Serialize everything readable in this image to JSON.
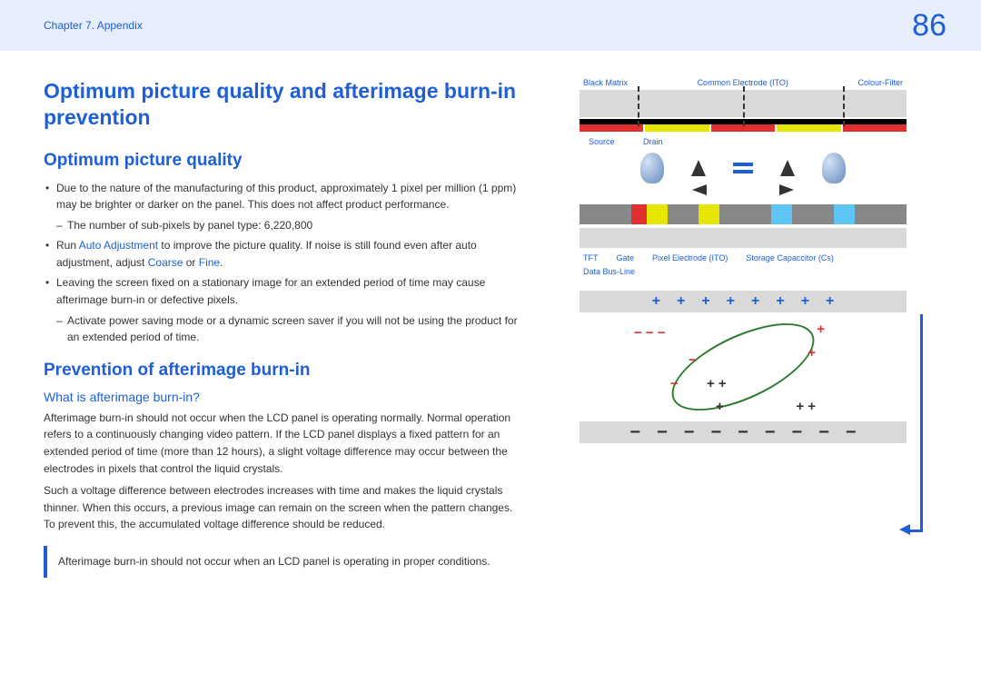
{
  "header": {
    "chapter": "Chapter 7. Appendix",
    "page": "86"
  },
  "title": "Optimum picture quality and afterimage burn-in prevention",
  "section1": {
    "heading": "Optimum picture quality",
    "b1": "Due to the nature of the manufacturing of this product, approximately 1 pixel per million (1 ppm) may be brighter or darker on the panel. This does not affect product performance.",
    "d1": "The number of sub-pixels by panel type: 6,220,800",
    "b2a": "Run ",
    "b2link": "Auto Adjustment",
    "b2b": " to improve the picture quality. If noise is still found even after auto adjustment, adjust ",
    "b2link2": "Coarse",
    "b2c": " or ",
    "b2link3": "Fine",
    "b2d": ".",
    "b3": "Leaving the screen fixed on a stationary image for an extended period of time may cause afterimage burn-in or defective pixels.",
    "d2": "Activate power saving mode or a dynamic screen saver if you will not be using the product for an extended period of time."
  },
  "section2": {
    "heading": "Prevention of afterimage burn-in",
    "sub": "What is afterimage burn-in?",
    "p1": "Afterimage burn-in should not occur when the LCD panel is operating normally. Normal operation refers to a continuously changing video pattern. If the LCD panel displays a fixed pattern for an extended period of time (more than 12 hours), a slight voltage difference may occur between the electrodes in pixels that control the liquid crystals.",
    "p2": "Such a voltage difference between electrodes increases with time and makes the liquid crystals thinner. When this occurs, a previous image can remain on the screen when the pattern changes. To prevent this, the accumulated voltage difference should be reduced.",
    "note": "Afterimage burn-in should not occur when an LCD panel is operating in proper conditions."
  },
  "diagram": {
    "top": {
      "black_matrix": "Black Matrix",
      "common_electrode": "Common Electrode (ITO)",
      "colour_filter": "Colour-Filter"
    },
    "mid": {
      "source": "Source",
      "drain": "Drain"
    },
    "bottom": {
      "tft": "TFT",
      "data_bus": "Data Bus-Line",
      "gate": "Gate",
      "pixel_electrode": "Pixel Electrode (ITO)",
      "storage_cap": "Storage Capaccitor (Cs)"
    }
  }
}
